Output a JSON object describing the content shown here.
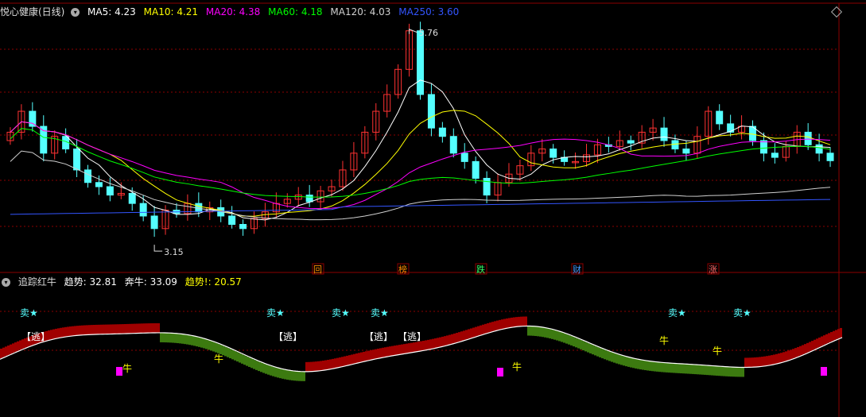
{
  "top": {
    "title": "悦心健康(日线)",
    "ma": [
      {
        "label": "MA5: 4.23",
        "color": "#ffffff"
      },
      {
        "label": "MA10: 4.21",
        "color": "#ffff00"
      },
      {
        "label": "MA20: 4.38",
        "color": "#ff00ff"
      },
      {
        "label": "MA60: 4.18",
        "color": "#00ff00"
      },
      {
        "label": "MA120: 4.03",
        "color": "#d0d0d0"
      },
      {
        "label": "MA250: 3.60",
        "color": "#3355ff"
      }
    ],
    "high_label": "5.76",
    "low_label": "3.15"
  },
  "bottom": {
    "title": "追踪红牛",
    "trend_label": "趋势: 32.81",
    "bull_label": "奔牛: 33.09",
    "trend_ex_label": "趋势!",
    "trend_ex_value": ": 20.57"
  },
  "markers": [
    "回",
    "榜",
    "跌",
    "财",
    "涨"
  ],
  "signals": {
    "sell": "卖★",
    "escape": "【逃】",
    "bull": "牛"
  },
  "colors": {
    "up": "#ff3232",
    "down": "#54ffff",
    "grid": "#8b0000",
    "bg": "#000000"
  },
  "chart_data": {
    "type": "candlestick",
    "ylim": [
      3.0,
      5.9
    ],
    "high_annotation": 5.76,
    "low_annotation": 3.15,
    "ohlc_close": [
      4.55,
      4.8,
      4.62,
      4.3,
      4.5,
      4.35,
      4.1,
      3.95,
      3.9,
      3.8,
      3.82,
      3.7,
      3.55,
      3.4,
      3.62,
      3.58,
      3.7,
      3.6,
      3.65,
      3.55,
      3.45,
      3.4,
      3.52,
      3.6,
      3.7,
      3.75,
      3.8,
      3.72,
      3.85,
      3.9,
      4.1,
      4.3,
      4.55,
      4.8,
      5.0,
      5.3,
      5.76,
      5.0,
      4.6,
      4.5,
      4.3,
      4.2,
      4.0,
      3.8,
      3.95,
      4.05,
      4.15,
      4.3,
      4.35,
      4.25,
      4.2,
      4.2,
      4.28,
      4.4,
      4.38,
      4.45,
      4.42,
      4.55,
      4.6,
      4.45,
      4.35,
      4.3,
      4.5,
      4.8,
      4.65,
      4.55,
      4.62,
      4.45,
      4.3,
      4.25,
      4.38,
      4.55,
      4.4,
      4.3,
      4.21
    ]
  }
}
